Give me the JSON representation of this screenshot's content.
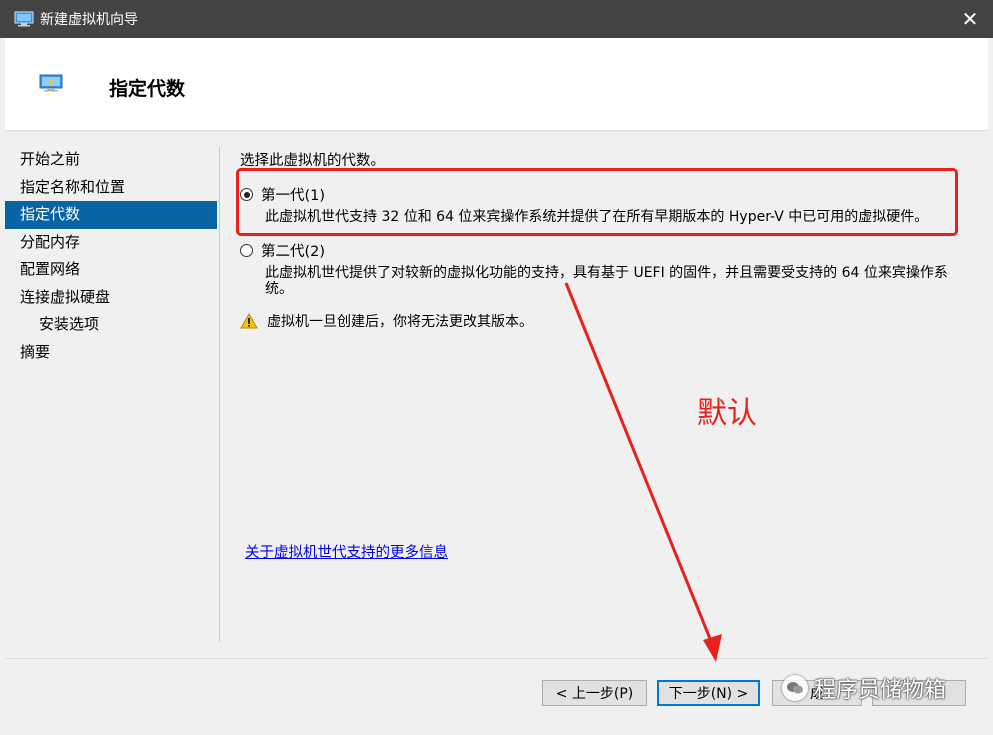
{
  "window": {
    "title": "新建虚拟机向导",
    "close_glyph": "✕"
  },
  "header": {
    "title": "指定代数"
  },
  "nav": {
    "items": [
      {
        "label": "开始之前"
      },
      {
        "label": "指定名称和位置"
      },
      {
        "label": "指定代数",
        "active": true
      },
      {
        "label": "分配内存"
      },
      {
        "label": "配置网络"
      },
      {
        "label": "连接虚拟硬盘"
      },
      {
        "label": "安装选项",
        "sub": true
      },
      {
        "label": "摘要"
      }
    ]
  },
  "content": {
    "prompt": "选择此虚拟机的代数。",
    "gen1": {
      "label": "第一代(1)",
      "checked": true,
      "description": "此虚拟机世代支持 32 位和 64 位来宾操作系统并提供了在所有早期版本的 Hyper-V 中已可用的虚拟硬件。"
    },
    "gen2": {
      "label": "第二代(2)",
      "checked": false,
      "description": "此虚拟机世代提供了对较新的虚拟化功能的支持，具有基于 UEFI 的固件，并且需要受支持的 64 位来宾操作系统。"
    },
    "warning": "虚拟机一旦创建后，你将无法更改其版本。",
    "more_info_link": "关于虚拟机世代支持的更多信息"
  },
  "footer": {
    "prev_button": "< 上一步(P)",
    "next_button": "下一步(N) >",
    "finish_button": "成",
    "cancel_button": ""
  },
  "annotation": {
    "text": "默认",
    "color": "#e8211a"
  },
  "watermark": {
    "text": "程序员储物箱"
  },
  "colors": {
    "titlebar": "#444444",
    "nav_active": "#0a64a4",
    "link": "#0000ee"
  }
}
